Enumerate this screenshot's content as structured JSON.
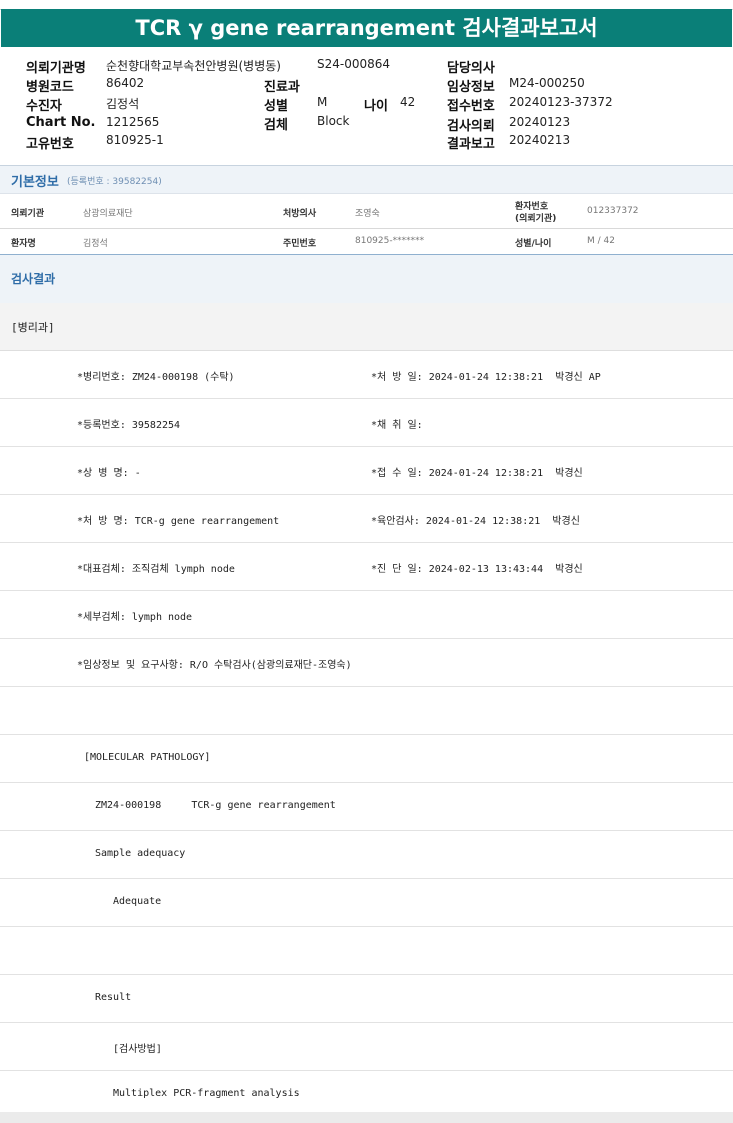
{
  "report": {
    "title": "TCR γ gene rearrangement 검사결과보고서"
  },
  "header": {
    "institution_label": "의뢰기관명",
    "institution_value": "순천향대학교부속천안병원(병병동)",
    "institution_code_value": "S24-000864",
    "doctor_label": "담당의사",
    "doctor_value": "",
    "hospital_code_label": "병원코드",
    "hospital_code_value": "86402",
    "department_label": "진료과",
    "department_value": "",
    "clinical_info_label": "임상정보",
    "clinical_info_value": "M24-000250",
    "patient_label": "수진자",
    "patient_value": "김정석",
    "sex_label": "성별",
    "sex_value": "M",
    "age_label": "나이",
    "age_value": "42",
    "receipt_no_label": "접수번호",
    "receipt_no_value": "20240123-37372",
    "chart_label": "Chart No.",
    "chart_value": "1212565",
    "specimen_label": "검체",
    "specimen_value": "Block",
    "request_label": "검사의뢰",
    "request_value": "20240123",
    "unique_label": "고유번호",
    "unique_value": "810925-1",
    "report_label": "결과보고",
    "report_value": "20240213"
  },
  "basic": {
    "title": "기본정보",
    "reg_no": "(등록번호 : 39582254)",
    "inst_label": "의뢰기관",
    "inst_value": "삼광의료재단",
    "presc_label": "처방의사",
    "presc_value": "조영숙",
    "patno_label": "환자번호",
    "patno_sub": "(의뢰기관)",
    "patno_value": "012337372",
    "name_label": "환자명",
    "name_value": "김정석",
    "rrn_label": "주민번호",
    "rrn_value": "810925-*******",
    "sexage_label": "성별/나이",
    "sexage_value": "M / 42"
  },
  "results": {
    "title": "검사결과",
    "dept": "[병리과]",
    "lines": [
      {
        "left": "*병리번호: ZM24-000198 (수탁)",
        "right": "*처 방 일: 2024-01-24 12:38:21  박경신 AP"
      },
      {
        "left": "*등록번호: 39582254",
        "right": "*채 취 일:"
      },
      {
        "left": "*상 병 명: -",
        "right": "*접 수 일: 2024-01-24 12:38:21  박경신"
      },
      {
        "left": "*처 방 명: TCR-g gene rearrangement",
        "right": "*육안검사: 2024-01-24 12:38:21  박경신"
      },
      {
        "left": "*대표검체: 조직검체 lymph node",
        "right": "*진 단 일: 2024-02-13 13:43:44  박경신"
      },
      {
        "left": "*세부검체: lymph node",
        "right": ""
      },
      {
        "left": "*임상정보 및 요구사항: R/O 수탁검사(삼광의료재단-조영숙)",
        "right": ""
      },
      {
        "left": "",
        "right": ""
      },
      {
        "left": "[MOLECULAR PATHOLOGY]",
        "right": ""
      },
      {
        "left": "ZM24-000198     TCR-g gene rearrangement",
        "right": ""
      },
      {
        "left": "Sample adequacy",
        "right": ""
      },
      {
        "left": "Adequate",
        "right": ""
      },
      {
        "left": "",
        "right": ""
      },
      {
        "left": "Result",
        "right": ""
      },
      {
        "left": "[검사방법]",
        "right": ""
      },
      {
        "left": "Multiplex PCR-fragment analysis",
        "right": ""
      }
    ]
  }
}
